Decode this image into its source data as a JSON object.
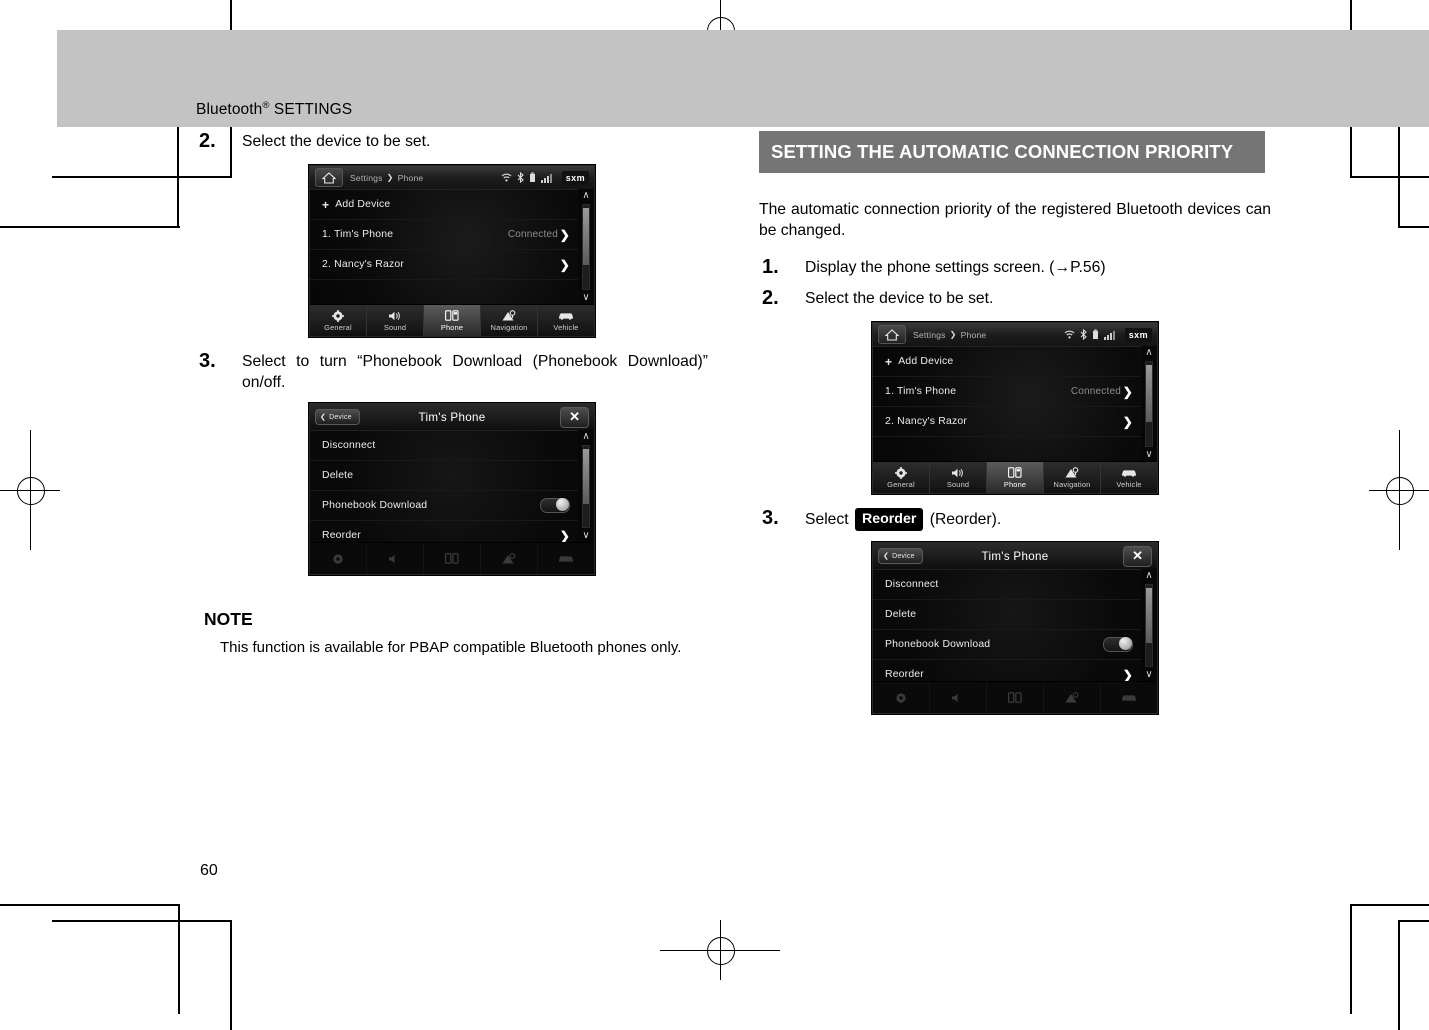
{
  "page": {
    "running_head": "Bluetooth",
    "running_head_sup": "®",
    "running_head_rest": " SETTINGS",
    "number": "60"
  },
  "colors": {
    "header_band": "#c3c3c3",
    "section_header": "#757575",
    "keycap": "#000000",
    "text": "#000000"
  },
  "left_column": {
    "steps": [
      {
        "num": "2.",
        "text": "Select the device to be set."
      },
      {
        "num": "3.",
        "text": "Select to turn “Phonebook Download (Phonebook Download)” on/off."
      }
    ],
    "note": {
      "title": "NOTE",
      "body": "This function is available for PBAP compatible Bluetooth phones only."
    }
  },
  "right_column": {
    "section_header": "SETTING THE AUTOMATIC CONNECTION PRIORITY",
    "intro": "The automatic connection priority of the registered Bluetooth devices can be changed.",
    "steps": [
      {
        "num": "1.",
        "text": "Display the phone settings screen. (→P.56)"
      },
      {
        "num": "2.",
        "text": "Select the device to be set."
      },
      {
        "num": "3.",
        "pre": "Select ",
        "keycap": "Reorder",
        "post": " (Reorder)."
      }
    ]
  },
  "device_list_screen": {
    "breadcrumb_root": "Settings",
    "breadcrumb_sep": "❯",
    "breadcrumb_leaf": "Phone",
    "status_icons": [
      "wifi-icon",
      "bluetooth-icon",
      "battery-icon",
      "signal-icon"
    ],
    "sxm_label": "sxm",
    "rows": [
      {
        "plus": "+",
        "label": "Add Device",
        "state": "",
        "arrow": ""
      },
      {
        "plus": "",
        "label": "1. Tim's Phone",
        "state": "Connected",
        "arrow": "❯"
      },
      {
        "plus": "",
        "label": "2. Nancy's Razor",
        "state": "",
        "arrow": "❯"
      }
    ],
    "scroll_up": "∧",
    "scroll_down": "∨",
    "tabs": [
      {
        "label": "General",
        "icon": "gear-icon",
        "active": false
      },
      {
        "label": "Sound",
        "icon": "speaker-icon",
        "active": false
      },
      {
        "label": "Phone",
        "icon": "phone-icon",
        "active": true
      },
      {
        "label": "Navigation",
        "icon": "navigation-icon",
        "active": false
      },
      {
        "label": "Vehicle",
        "icon": "car-icon",
        "active": false
      }
    ]
  },
  "device_detail_screen": {
    "back_label": "Device",
    "back_chevron": "❮",
    "title": "Tim's Phone",
    "close_label": "✕",
    "rows": [
      {
        "label": "Disconnect",
        "control": "none"
      },
      {
        "label": "Delete",
        "control": "none"
      },
      {
        "label": "Phonebook Download",
        "control": "toggle"
      },
      {
        "label": "Reorder",
        "control": "arrow",
        "arrow": "❯"
      }
    ],
    "scroll_up": "∧",
    "scroll_down": "∨",
    "tabs": [
      {
        "label": "",
        "icon": "gear-icon"
      },
      {
        "label": "",
        "icon": "speaker-icon"
      },
      {
        "label": "",
        "icon": "phone-icon"
      },
      {
        "label": "",
        "icon": "navigation-icon"
      },
      {
        "label": "",
        "icon": "car-icon"
      }
    ]
  }
}
